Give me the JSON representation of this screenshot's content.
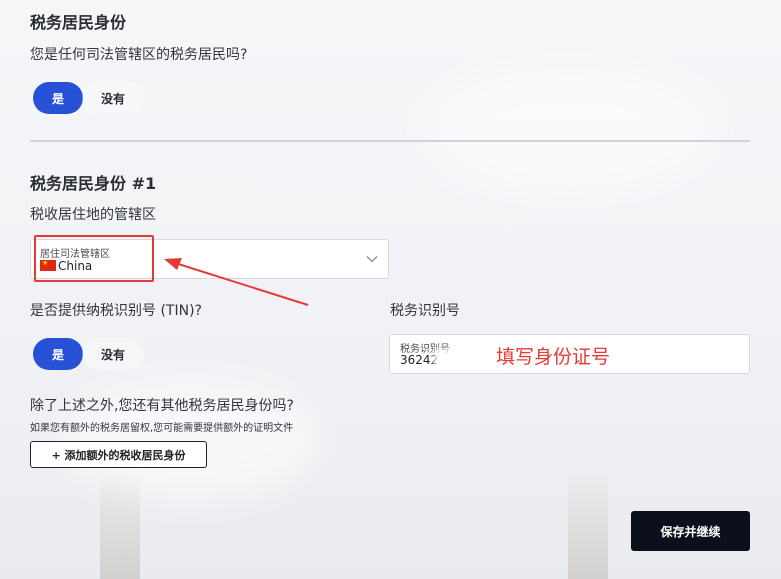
{
  "section1": {
    "title": "税务居民身份",
    "question": "您是任何司法管辖区的税务居民吗?",
    "yes_label": "是",
    "no_label": "没有"
  },
  "section2": {
    "title": "税务居民身份 #1",
    "jurisdiction_heading": "税收居住地的管辖区",
    "jurisdiction_field": {
      "label": "居住司法管辖区",
      "value": "China",
      "flag_icon": "china-flag-icon"
    },
    "tin_question": "是否提供纳税识别号 (TIN)?",
    "tin_yes_label": "是",
    "tin_no_label": "没有",
    "tin_heading": "税务识别号",
    "tin_field": {
      "label": "税务识别号",
      "value": "36242"
    },
    "annotation_text": "填写身份证号",
    "other_question": "除了上述之外,您还有其他税务居民身份吗?",
    "other_note": "如果您有额外的税务居留权,您可能需要提供额外的证明文件",
    "add_button_label": "+ 添加额外的税收居民身份"
  },
  "footer": {
    "continue_label": "保存并继续"
  },
  "colors": {
    "accent": "#2851d8",
    "annotation": "#e53935",
    "primary_button": "#0c0f1c"
  }
}
